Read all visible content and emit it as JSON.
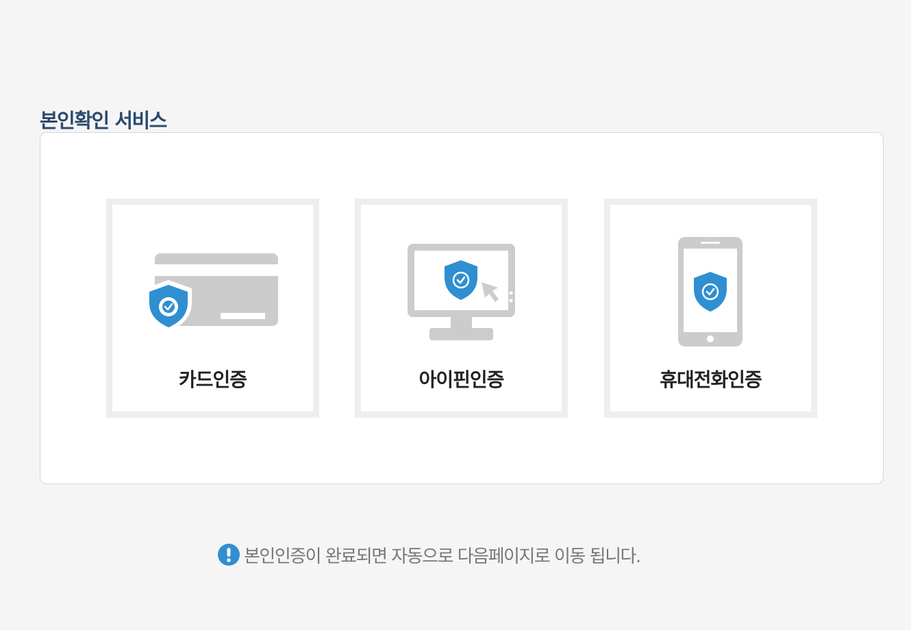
{
  "page": {
    "title": "본인확인 서비스"
  },
  "options": [
    {
      "id": "card",
      "label": "카드인증",
      "icon": "credit-card-shield-icon"
    },
    {
      "id": "ipin",
      "label": "아이핀인증",
      "icon": "monitor-shield-icon"
    },
    {
      "id": "phone",
      "label": "휴대전화인증",
      "icon": "mobile-phone-shield-icon"
    }
  ],
  "notice": {
    "icon": "exclamation-icon",
    "text": "본인인증이 완료되면 자동으로 다음페이지로 이동 됩니다."
  },
  "colors": {
    "title": "#2a4a6e",
    "shield": "#2f8fd0",
    "icon_gray": "#cccccc",
    "box_border": "#eeeeee",
    "notice_text": "#777777"
  }
}
